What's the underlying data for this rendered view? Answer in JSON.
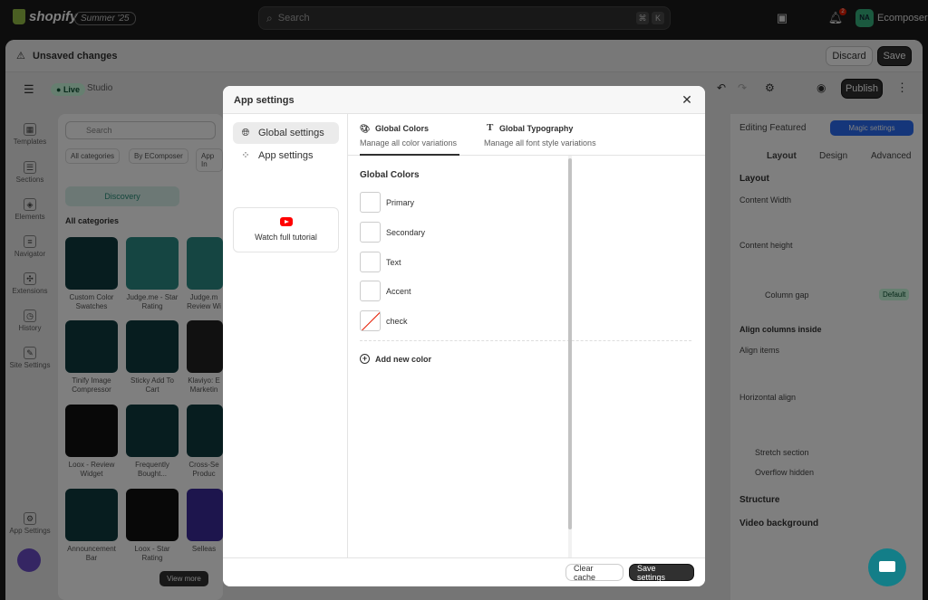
{
  "topbar": {
    "brand": "shopify",
    "edition": "Summer '25",
    "search_placeholder": "Search",
    "shortcut_key1": "⌘",
    "shortcut_key2": "K",
    "notification_count": "2",
    "avatar_initials": "NA",
    "store_name": "Ecomposer"
  },
  "unsaved_bar": {
    "message": "Unsaved changes",
    "discard_label": "Discard",
    "save_label": "Save"
  },
  "editor_bar": {
    "live_label": "Live",
    "studio_label": "Studio",
    "publish_label": "Publish"
  },
  "left_rail": [
    {
      "label": "Templates",
      "icon": "templates-icon"
    },
    {
      "label": "Sections",
      "icon": "sections-icon"
    },
    {
      "label": "Elements",
      "icon": "elements-icon"
    },
    {
      "label": "Navigator",
      "icon": "navigator-icon"
    },
    {
      "label": "Extensions",
      "icon": "extensions-icon"
    },
    {
      "label": "History",
      "icon": "history-icon"
    },
    {
      "label": "Site Settings",
      "icon": "site-settings-icon"
    },
    {
      "label": "App Settings",
      "icon": "app-settings-icon"
    }
  ],
  "left_panel": {
    "search_placeholder": "Search",
    "filters": [
      "All categories",
      "By EComposer",
      "App In"
    ],
    "discovery_label": "Discovery",
    "all_categories_label": "All categories",
    "cards": [
      {
        "label": "Custom Color Swatches"
      },
      {
        "label": "Judge.me - Star Rating"
      },
      {
        "label": "Judge.m Review Wi"
      },
      {
        "label": "Tinify Image Compressor"
      },
      {
        "label": "Sticky Add To Cart"
      },
      {
        "label": "Klaviyo: E Marketin"
      },
      {
        "label": "Loox - Review Widget"
      },
      {
        "label": "Frequently Bought..."
      },
      {
        "label": "Cross-Se Produc"
      },
      {
        "label": "Announcement Bar"
      },
      {
        "label": "Loox - Star Rating"
      },
      {
        "label": "Selleas"
      }
    ],
    "view_more_label": "View more"
  },
  "right_panel": {
    "editing_label": "Editing Featured",
    "magic_label": "Magic settings",
    "tabs": [
      "Layout",
      "Design",
      "Advanced"
    ],
    "layout_head": "Layout",
    "content_width": "Content Width",
    "content_height": "Content height",
    "column_gap": "Column gap",
    "default_badge": "Default",
    "align_columns": "Align columns inside",
    "align_items": "Align items",
    "horizontal_align": "Horizontal align",
    "stretch_section": "Stretch section",
    "overflow_hidden": "Overflow hidden",
    "structure": "Structure",
    "video_background": "Video background"
  },
  "modal": {
    "title": "App settings",
    "nav": [
      {
        "label": "Global settings",
        "icon": "globe-icon",
        "active": true
      },
      {
        "label": "App settings",
        "icon": "apps-icon",
        "active": false
      }
    ],
    "tutorial_label": "Watch full tutorial",
    "tabs": [
      {
        "title": "Global Colors",
        "subtitle": "Manage all color variations",
        "icon": "paint-bucket-icon",
        "active": true
      },
      {
        "title": "Global Typography",
        "subtitle": "Manage all font style variations",
        "icon": "typography-icon",
        "active": false
      }
    ],
    "section_title": "Global Colors",
    "colors": [
      {
        "name": "Primary",
        "value": "#ffffff"
      },
      {
        "name": "Secondary",
        "value": "#ffffff"
      },
      {
        "name": "Text",
        "value": "#ffffff"
      },
      {
        "name": "Accent",
        "value": "#ffffff"
      },
      {
        "name": "check",
        "value": "none"
      }
    ],
    "add_color_label": "Add new color",
    "clear_cache_label": "Clear cache",
    "save_settings_label": "Save settings"
  }
}
